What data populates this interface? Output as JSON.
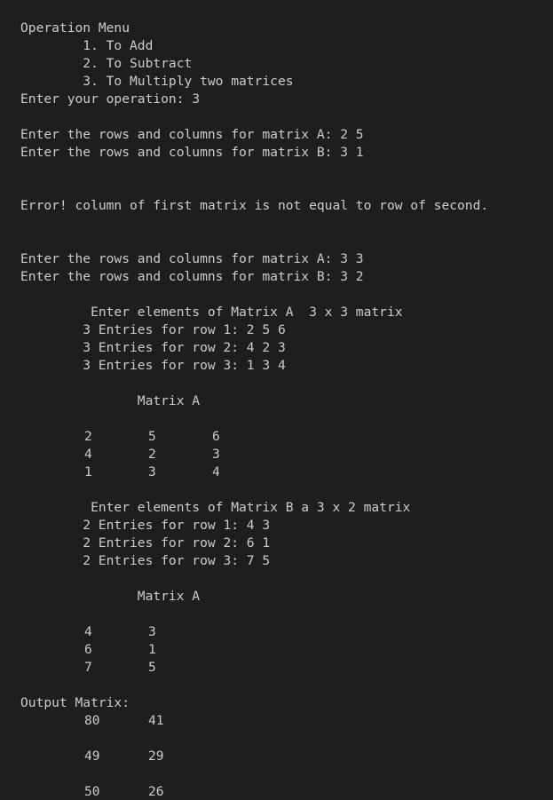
{
  "menu": {
    "title": "Operation Menu",
    "opt1": "        1. To Add",
    "opt2": "        2. To Subtract",
    "opt3": "        3. To Multiply two matrices",
    "prompt": "Enter your operation: 3"
  },
  "attempt1": {
    "a": "Enter the rows and columns for matrix A: 2 5",
    "b": "Enter the rows and columns for matrix B: 3 1",
    "error": "Error! column of first matrix is not equal to row of second."
  },
  "attempt2": {
    "a": "Enter the rows and columns for matrix A: 3 3",
    "b": "Enter the rows and columns for matrix B: 3 2"
  },
  "matrixA": {
    "header": "         Enter elements of Matrix A  3 x 3 matrix",
    "row1": "        3 Entries for row 1: 2 5 6",
    "row2": "        3 Entries for row 2: 4 2 3",
    "row3": "        3 Entries for row 3: 1 3 4",
    "title": "               Matrix A",
    "rows": [
      [
        "2",
        "5",
        "6"
      ],
      [
        "4",
        "2",
        "3"
      ],
      [
        "1",
        "3",
        "4"
      ]
    ]
  },
  "matrixB": {
    "header": "         Enter elements of Matrix B a 3 x 2 matrix",
    "row1": "        2 Entries for row 1: 4 3",
    "row2": "        2 Entries for row 2: 6 1",
    "row3": "        2 Entries for row 3: 7 5",
    "title": "               Matrix A",
    "rows": [
      [
        "4",
        "3"
      ],
      [
        "6",
        "1"
      ],
      [
        "7",
        "5"
      ]
    ]
  },
  "output": {
    "title": "Output Matrix:",
    "rows": [
      [
        "80",
        "41"
      ],
      [
        "49",
        "29"
      ],
      [
        "50",
        "26"
      ]
    ]
  }
}
